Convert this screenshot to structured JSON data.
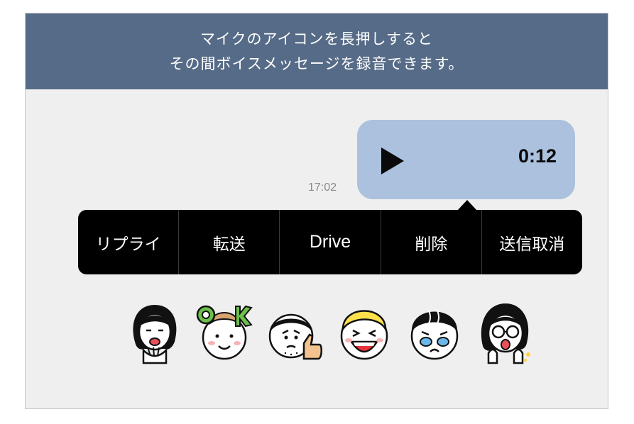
{
  "banner": {
    "line1": "マイクのアイコンを長押しすると",
    "line2": "その間ボイスメッセージを録音できます。"
  },
  "message": {
    "time": "17:02",
    "duration": "0:12"
  },
  "context_menu": {
    "items": [
      {
        "label": "リプライ"
      },
      {
        "label": "転送"
      },
      {
        "label": "Drive"
      },
      {
        "label": "削除"
      },
      {
        "label": "送信取消"
      }
    ]
  },
  "reactions": [
    {
      "icon": "woman-long-hair-sticker"
    },
    {
      "icon": "ok-boy-sticker"
    },
    {
      "icon": "man-thumbs-up-sticker"
    },
    {
      "icon": "laughing-boy-sticker"
    },
    {
      "icon": "crying-boy-sticker"
    },
    {
      "icon": "woman-glasses-surprised-sticker"
    }
  ],
  "colors": {
    "banner_bg": "#566b87",
    "chat_bg": "#efefef",
    "bubble": "#abc1de",
    "menu_bg": "#000000"
  }
}
